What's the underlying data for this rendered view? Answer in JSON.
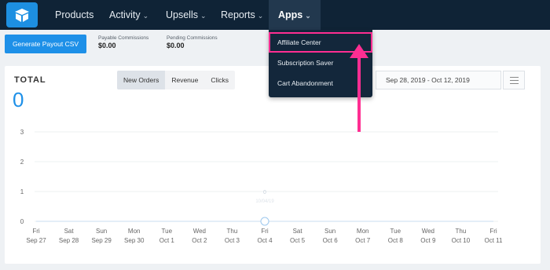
{
  "nav": {
    "items": [
      {
        "label": "Products",
        "chevron": false
      },
      {
        "label": "Activity",
        "chevron": true
      },
      {
        "label": "Upsells",
        "chevron": true
      },
      {
        "label": "Reports",
        "chevron": true
      },
      {
        "label": "Apps",
        "chevron": true,
        "active": true
      }
    ],
    "chevron_glyph": "⌄",
    "logo_icon": "box-icon"
  },
  "subbar": {
    "payout_button": "Generate Payout CSV",
    "payable_label": "Payable Commissions",
    "payable_value": "$0.00",
    "pending_label": "Pending Commissions",
    "pending_value": "$0.00"
  },
  "dropdown": {
    "items": [
      "Affiliate Center",
      "Subscription Saver",
      "Cart Abandonment"
    ],
    "highlighted_index": 0
  },
  "card": {
    "total_label": "TOTAL",
    "total_value": "0",
    "tabs": [
      "New Orders",
      "Revenue",
      "Clicks"
    ],
    "active_tab": "New Orders",
    "date_range": "Sep 28, 2019  -  Oct 12, 2019"
  },
  "chart_data": {
    "type": "line",
    "y_ticks": [
      "0",
      "1",
      "2",
      "3"
    ],
    "ylim": [
      0,
      3
    ],
    "x_days": [
      "Fri",
      "Sat",
      "Sun",
      "Mon",
      "Tue",
      "Wed",
      "Thu",
      "Fri",
      "Sat",
      "Sun",
      "Mon",
      "Tue",
      "Wed",
      "Thu",
      "Fri"
    ],
    "x_dates": [
      "Sep 27",
      "Sep 28",
      "Sep 29",
      "Sep 30",
      "Oct 1",
      "Oct 2",
      "Oct 3",
      "Oct 4",
      "Oct 5",
      "Oct 6",
      "Oct 7",
      "Oct 8",
      "Oct 9",
      "Oct 10",
      "Oct 11"
    ],
    "series": [
      {
        "values": [
          0,
          0,
          0,
          0,
          0,
          0,
          0,
          0,
          0,
          0,
          0,
          0,
          0,
          0,
          0
        ]
      }
    ],
    "hover": {
      "index": 7,
      "value_label": "0",
      "date_label": "10/04/19"
    },
    "grid": true
  },
  "colors": {
    "accent": "#1e90e8",
    "nav_bg": "#0f2336",
    "highlight": "#ff2e92"
  }
}
